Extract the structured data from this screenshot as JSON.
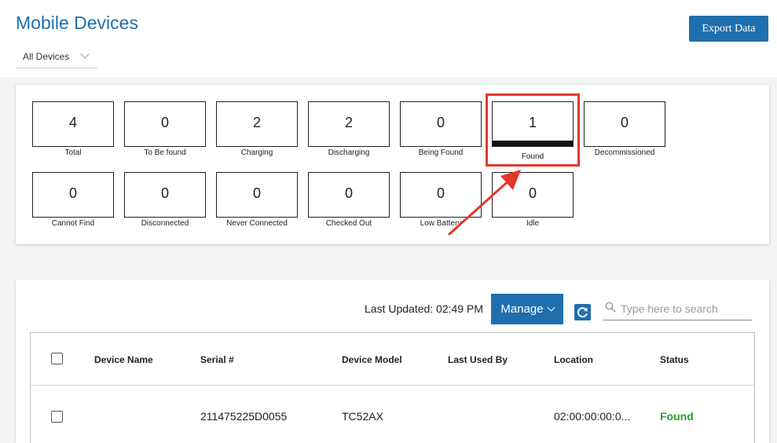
{
  "header": {
    "title": "Mobile Devices",
    "export_label": "Export Data",
    "filter_value": "All Devices"
  },
  "stats": {
    "row1": [
      {
        "value": "4",
        "label": "Total"
      },
      {
        "value": "0",
        "label": "To Be found"
      },
      {
        "value": "2",
        "label": "Charging"
      },
      {
        "value": "2",
        "label": "Discharging"
      },
      {
        "value": "0",
        "label": "Being Found"
      },
      {
        "value": "1",
        "label": "Found"
      },
      {
        "value": "0",
        "label": "Decommissioned"
      }
    ],
    "row2": [
      {
        "value": "0",
        "label": "Cannot Find"
      },
      {
        "value": "0",
        "label": "Disconnected"
      },
      {
        "value": "0",
        "label": "Never Connected"
      },
      {
        "value": "0",
        "label": "Checked Out"
      },
      {
        "value": "0",
        "label": "Low Battery"
      },
      {
        "value": "0",
        "label": "Idle"
      }
    ]
  },
  "toolbar": {
    "last_updated": "Last Updated: 02:49 PM",
    "manage_label": "Manage",
    "search_placeholder": "Type here to search"
  },
  "table": {
    "columns": [
      "Device Name",
      "Serial #",
      "Device Model",
      "Last Used By",
      "Location",
      "Status"
    ],
    "rows": [
      {
        "device_name": "",
        "serial": "211475225D0055",
        "model": "TC52AX",
        "last_used_by": "",
        "location": "02:00:00:00:0...",
        "status": "Found"
      }
    ]
  },
  "colors": {
    "accent": "#1f6fae",
    "highlight": "#e2382b",
    "status_found": "#2e9e2e"
  }
}
